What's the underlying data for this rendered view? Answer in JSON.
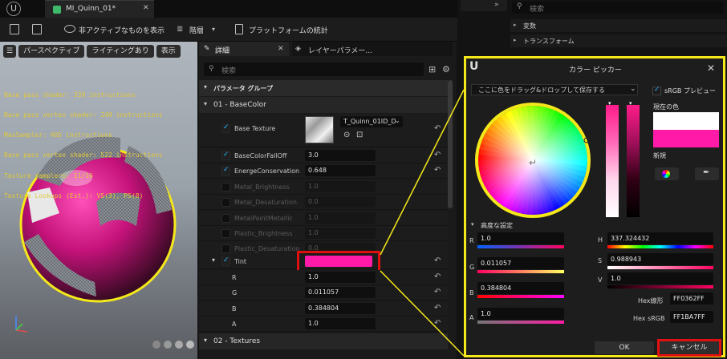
{
  "tab": {
    "title": "MI_Quinn_01*",
    "close": "✕"
  },
  "toolbar": {
    "hide_inactive": "非アクティブなものを表示",
    "hierarchy": "階層",
    "platform_stats": "プラットフォームの統計"
  },
  "viewport": {
    "perspective": "パースペクティブ",
    "lit": "ライティングあり",
    "show": "表示",
    "stats": [
      "Base pass shader: 339 instructions",
      "Base pass vertex shader: 249 instructions",
      "MaxSampler: 405 instructions",
      "Base pass vertex shader: 522 instructions",
      "Texture samplers: 11/16",
      "Texture Lookups (Est.): VS(3), PS(8)"
    ]
  },
  "details": {
    "tab": "詳細",
    "tab2": "レイヤーパラメー...",
    "search_placeholder": "検索",
    "param_groups": "パラメータ グループ",
    "group1": "01 - BaseColor",
    "group2": "02 - Textures",
    "base_texture": {
      "label": "Base Texture",
      "asset": "T_Quinn_01ID_D"
    },
    "rows": [
      {
        "label": "BaseColorFallOff",
        "value": "3.0",
        "enabled": true
      },
      {
        "label": "EnergeConservation",
        "value": "0.648",
        "enabled": true
      },
      {
        "label": "Metal_Brightness",
        "value": "1.0",
        "enabled": false
      },
      {
        "label": "Metal_Desaturation",
        "value": "0.0",
        "enabled": false
      },
      {
        "label": "MetalPaintMetallic",
        "value": "1.0",
        "enabled": false
      },
      {
        "label": "Plastic_Brightness",
        "value": "1.0",
        "enabled": false
      },
      {
        "label": "Plastic_Desaturation",
        "value": "0.0",
        "enabled": false
      }
    ],
    "tint": {
      "label": "Tint",
      "color": "#FF0362"
    },
    "channels": [
      {
        "label": "R",
        "value": "1.0"
      },
      {
        "label": "G",
        "value": "0.011057"
      },
      {
        "label": "B",
        "value": "0.384804"
      },
      {
        "label": "A",
        "value": "1.0"
      }
    ]
  },
  "right_panel": {
    "search_placeholder": "検索",
    "variables": "変数",
    "transform": "トランスフォーム"
  },
  "picker": {
    "title": "カラー ピッカー",
    "save_drop": "ここに色をドラッグ&ドロップして保存する",
    "srgb_preview": "sRGB プレビュー",
    "current_label": "現在の色",
    "new_label": "新規",
    "advanced": "高度な設定",
    "R": "1.0",
    "G": "0.011057",
    "B": "0.384804",
    "A": "1.0",
    "H": "337.324432",
    "S": "0.988943",
    "V": "1.0",
    "hex_linear_label": "Hex線形",
    "hex_linear": "FF0362FF",
    "hex_srgb_label": "Hex sRGB",
    "hex_srgb": "FF1BA7FF",
    "ok": "OK",
    "cancel": "キャンセル",
    "current_color": "#FFFFFF",
    "new_color": "#FF1BA7"
  }
}
